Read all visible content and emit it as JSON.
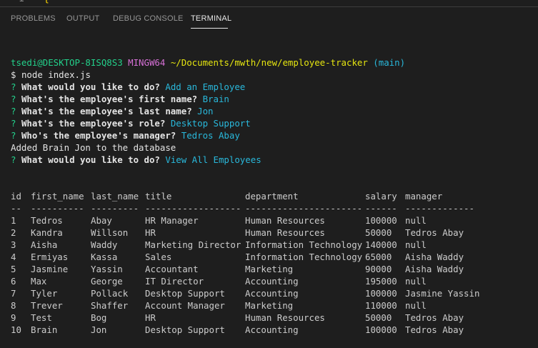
{
  "editor": {
    "line_number": "1",
    "brace": "{"
  },
  "tabs": [
    {
      "label": "PROBLEMS"
    },
    {
      "label": "OUTPUT"
    },
    {
      "label": "DEBUG CONSOLE"
    },
    {
      "label": "TERMINAL"
    }
  ],
  "prompt": {
    "user_host": "tsedi@DESKTOP-8ISQ8S3",
    "shell": "MINGW64",
    "path": "~/Documents/mwth/new/employee-tracker",
    "branch": "(main)",
    "dollar": "$",
    "command": "node index.js"
  },
  "qa": [
    {
      "mark": "?",
      "question": "What would you like to do?",
      "answer": "Add an Employee"
    },
    {
      "mark": "?",
      "question": "What's the employee's first name?",
      "answer": "Brain"
    },
    {
      "mark": "?",
      "question": "What's the employee's last name?",
      "answer": "Jon"
    },
    {
      "mark": "?",
      "question": "What's the employee's role?",
      "answer": "Desktop Support"
    },
    {
      "mark": "?",
      "question": "Who's the employee's manager?",
      "answer": "Tedros Abay"
    }
  ],
  "output_message": "Added Brain Jon to the database",
  "qa_after": {
    "mark": "?",
    "question": "What would you like to do?",
    "answer": "View All Employees"
  },
  "table": {
    "headers": [
      "id",
      "first_name",
      "last_name",
      "title",
      "department",
      "salary",
      "manager"
    ],
    "separators": [
      "--",
      "----------",
      "---------",
      "------------------",
      "----------------------",
      "------",
      "-------------"
    ],
    "rows": [
      [
        "1",
        "Tedros",
        "Abay",
        "HR Manager",
        "Human Resources",
        "100000",
        "null"
      ],
      [
        "2",
        "Kandra",
        "Willson",
        "HR",
        "Human Resources",
        "50000",
        "Tedros Abay"
      ],
      [
        "3",
        "Aisha",
        "Waddy",
        "Marketing Director",
        "Information Technology",
        "140000",
        "null"
      ],
      [
        "4",
        "Ermiyas",
        "Kassa",
        "Sales",
        "Information Technology",
        "65000",
        "Aisha Waddy"
      ],
      [
        "5",
        "Jasmine",
        "Yassin",
        "Accountant",
        "Marketing",
        "90000",
        "Aisha Waddy"
      ],
      [
        "6",
        "Max",
        "George",
        "IT Director",
        "Accounting",
        "195000",
        "null"
      ],
      [
        "7",
        "Tyler",
        "Pollack",
        "Desktop Support",
        "Accounting",
        "100000",
        "Jasmine Yassin"
      ],
      [
        "8",
        "Trever",
        "Shaffer",
        "Account Manager",
        "Marketing",
        "110000",
        "null"
      ],
      [
        "9",
        "Test",
        "Bog",
        "HR",
        "Human Resources",
        "50000",
        "Tedros Abay"
      ],
      [
        "10",
        "Brain",
        "Jon",
        "Desktop Support",
        "Accounting",
        "100000",
        "Tedros Abay"
      ]
    ]
  }
}
